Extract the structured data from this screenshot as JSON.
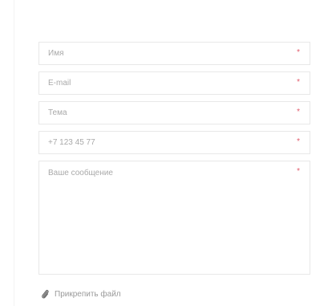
{
  "form": {
    "fields": [
      {
        "placeholder": "Имя",
        "required_mark": "*"
      },
      {
        "placeholder": "E-mail",
        "required_mark": "*"
      },
      {
        "placeholder": "Тема",
        "required_mark": "*"
      },
      {
        "placeholder": "+7 123 45 77",
        "required_mark": "*"
      }
    ],
    "message": {
      "placeholder": "Ваше сообщение",
      "required_mark": "*"
    },
    "attach": {
      "label": "Прикрепить файл",
      "icon": "paperclip-icon"
    },
    "colors": {
      "required": "#e25b6c",
      "border": "#e8e8e8",
      "placeholder": "#a9a9a9"
    }
  }
}
